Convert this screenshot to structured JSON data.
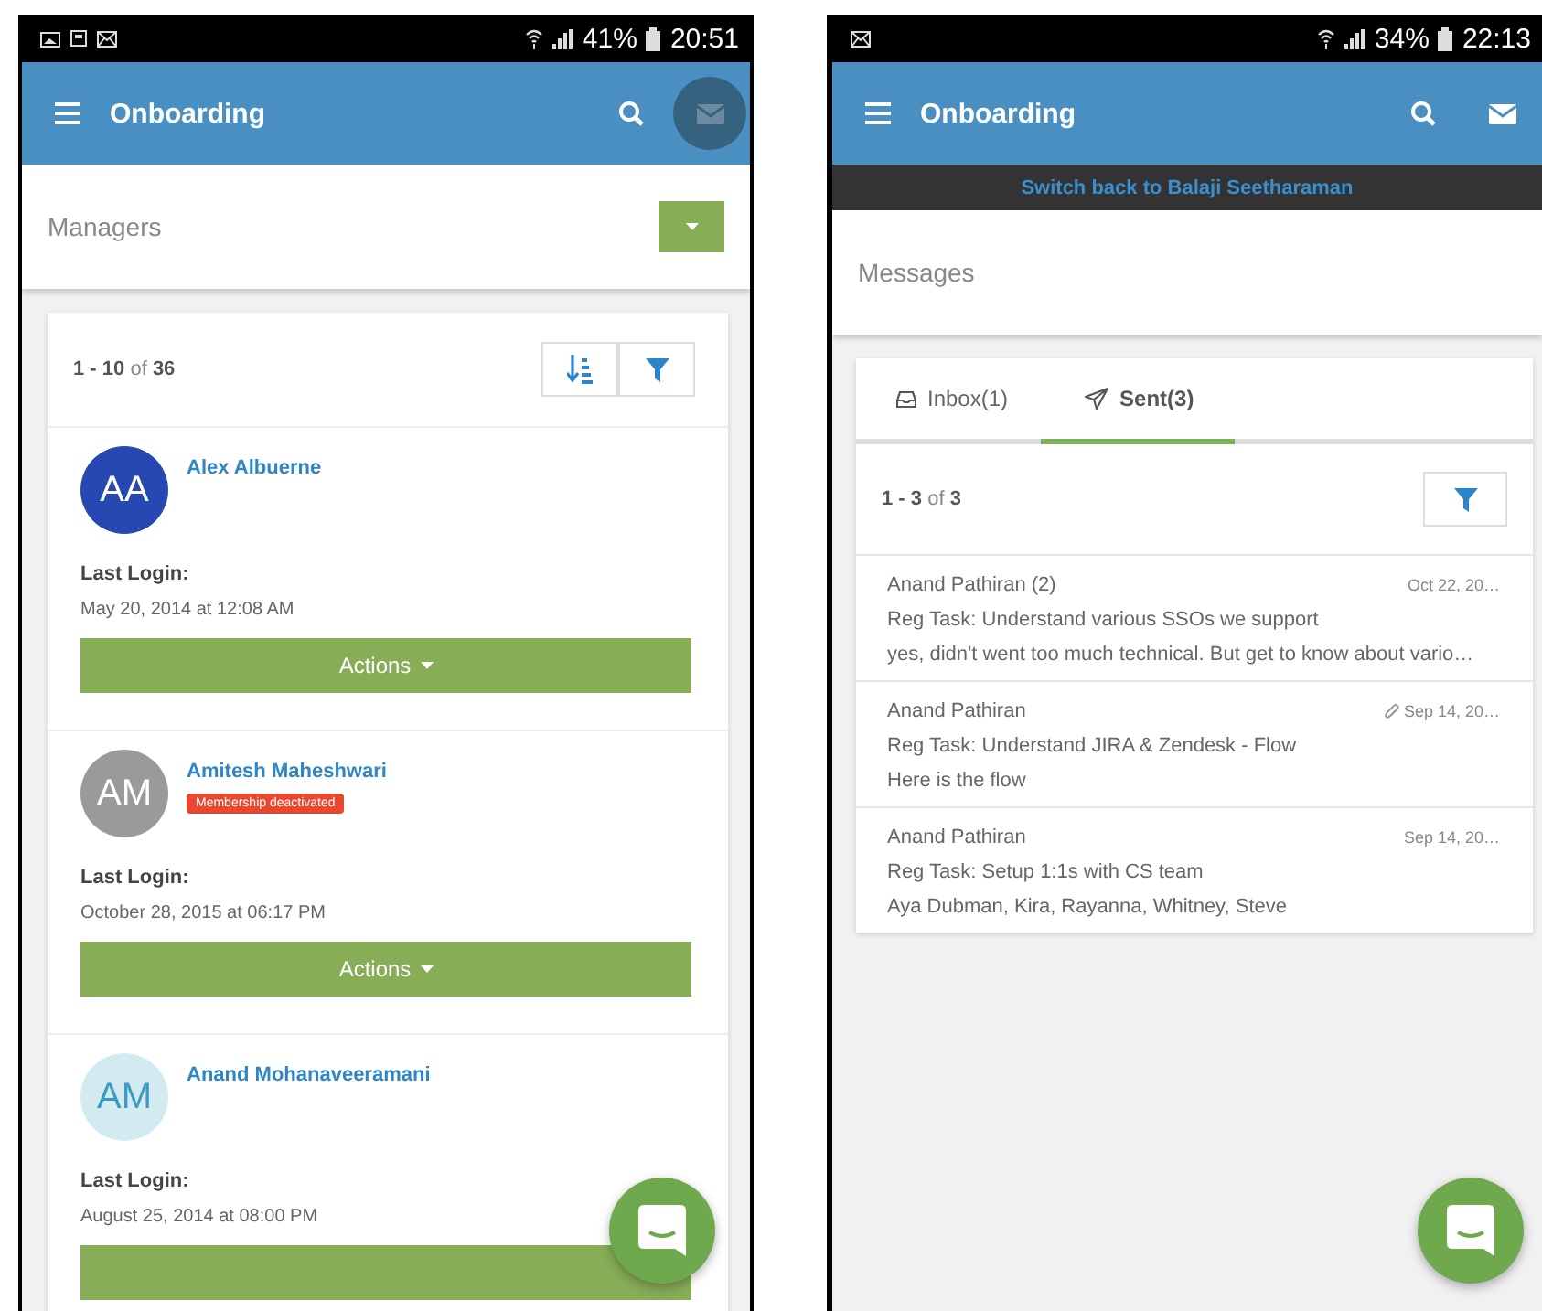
{
  "left_screen": {
    "status_bar": {
      "battery": "41%",
      "time": "20:51"
    },
    "header": {
      "title": "Onboarding",
      "mail_pressed": true
    },
    "section_title": "Managers",
    "pager": "**1 - 10** of **36**",
    "managers": [
      {
        "initials": "AA",
        "color": "#2748b0",
        "name": "Alex Albuerne",
        "login_label": "Last Login:",
        "login": "May 20, 2014 at 12:08 AM",
        "action": "Actions"
      },
      {
        "initials": "AM",
        "color": "#9a9a9a",
        "name": "Amitesh Maheshwari",
        "badge": "Membership deactivated",
        "login_label": "Last Login:",
        "login": "October 28, 2015 at 06:17 PM",
        "action": "Actions"
      },
      {
        "initials": "AM",
        "color": "#d3eaf0",
        "name": "Anand Mohanaveeramani",
        "login_label": "Last Login:",
        "login": "August 25, 2014 at 08:00 PM"
      }
    ]
  },
  "right_screen": {
    "status_bar": {
      "battery": "34%",
      "time": "22:13"
    },
    "header": {
      "title": "Onboarding",
      "mail_pressed": false
    },
    "switch_banner": "Switch back to Balaji Seetharaman",
    "section_title": "Messages",
    "tabs": [
      {
        "kind": "inbox",
        "label": "Inbox(1)",
        "selected": false
      },
      {
        "kind": "sent",
        "label": "Sent(3)",
        "selected": true
      }
    ],
    "pager": "**1 - 3** of **3**",
    "messages": [
      {
        "sender": "Anand Pathiran (2)",
        "attachment": false,
        "date": "Oct 22, 20…",
        "subject": "Reg Task: Understand various SSOs we support",
        "preview": "yes, didn't went too much technical. But get to know about vario…"
      },
      {
        "sender": "Anand Pathiran",
        "attachment": true,
        "date": "Sep 14, 20…",
        "subject": "Reg Task: Understand JIRA & Zendesk - Flow",
        "preview": "Here is the flow"
      },
      {
        "sender": "Anand Pathiran",
        "attachment": false,
        "date": "Sep 14, 20…",
        "subject": "Reg Task: Setup 1:1s with CS team",
        "preview": "Aya Dubman, Kira, Rayanna, Whitney, Steve"
      }
    ]
  }
}
